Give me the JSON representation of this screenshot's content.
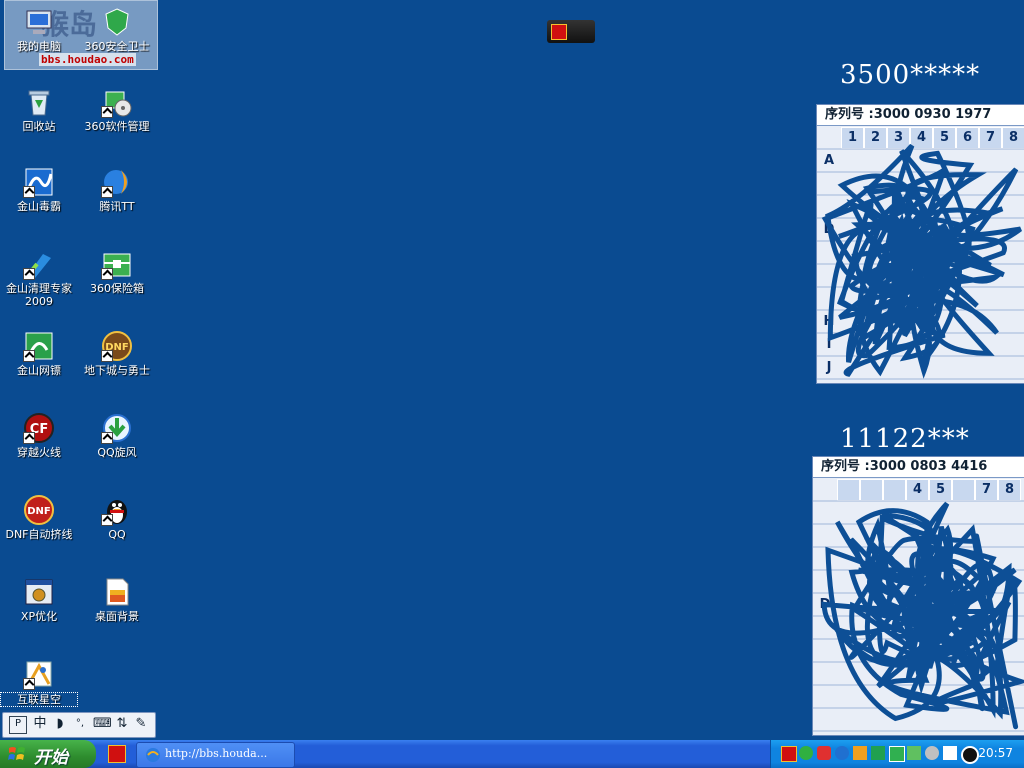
{
  "watermark": {
    "logo_text": "猴岛",
    "url": "bbs.houdao.com"
  },
  "desktop_icons": [
    {
      "id": "my-computer",
      "label": "我的电脑",
      "icon": "computer-icon"
    },
    {
      "id": "360-safe",
      "label": "360安全卫士",
      "icon": "shield-icon"
    },
    {
      "id": "recycle-bin",
      "label": "回收站",
      "icon": "recycle-bin-icon"
    },
    {
      "id": "360-soft-manager",
      "label": "360软件管理",
      "icon": "software-manager-icon"
    },
    {
      "id": "kingsoft-antivirus",
      "label": "金山毒霸",
      "icon": "antivirus-icon"
    },
    {
      "id": "tencent-tt",
      "label": "腾讯TT",
      "icon": "browser-icon"
    },
    {
      "id": "kingsoft-cleaner",
      "label": "金山清理专家\n2009",
      "icon": "cleaner-icon"
    },
    {
      "id": "360-safebox",
      "label": "360保险箱",
      "icon": "safebox-icon"
    },
    {
      "id": "kingsoft-shield",
      "label": "金山网镖",
      "icon": "firewall-icon"
    },
    {
      "id": "dnf",
      "label": "地下城与勇士",
      "icon": "dnf-icon"
    },
    {
      "id": "crossfire",
      "label": "穿越火线",
      "icon": "crossfire-icon"
    },
    {
      "id": "qq-whirlwind",
      "label": "QQ旋风",
      "icon": "download-icon"
    },
    {
      "id": "dnf-auto",
      "label": "DNF自动挤线",
      "icon": "dnf-auto-icon"
    },
    {
      "id": "qq",
      "label": "QQ",
      "icon": "qq-penguin-icon"
    },
    {
      "id": "xp-optimize",
      "label": "XP优化",
      "icon": "optimizer-icon"
    },
    {
      "id": "wallpaper",
      "label": "桌面背景",
      "icon": "wallpaper-icon"
    },
    {
      "id": "netstar",
      "label": "互联星空",
      "icon": "netstar-icon"
    }
  ],
  "cards": [
    {
      "title": "3500*****",
      "serial": "序列号 :3000  0930  1977",
      "columns": [
        "1",
        "2",
        "3",
        "4",
        "5",
        "6",
        "7",
        "8"
      ],
      "rows": [
        "A",
        "",
        "",
        "D",
        "",
        "",
        "",
        "H",
        "I",
        "J"
      ]
    },
    {
      "title": "11122***",
      "serial": "序列号 :3000  0803  4416",
      "columns": [
        "",
        "",
        "",
        "4",
        "5",
        "",
        "7",
        "8"
      ],
      "rows": [
        "",
        "",
        "",
        "",
        "D",
        "",
        "",
        "",
        "",
        "",
        "J"
      ]
    }
  ],
  "taskbar": {
    "start_label": "开始",
    "task_button_label": "http://bbs.houda...",
    "clock": "20:57"
  },
  "langbar": {
    "items": [
      "中"
    ]
  },
  "colors": {
    "desktop": "#0a4b91",
    "taskbar": "#235ed8",
    "start": "#2e8c2e",
    "tray": "#0f84e0"
  }
}
